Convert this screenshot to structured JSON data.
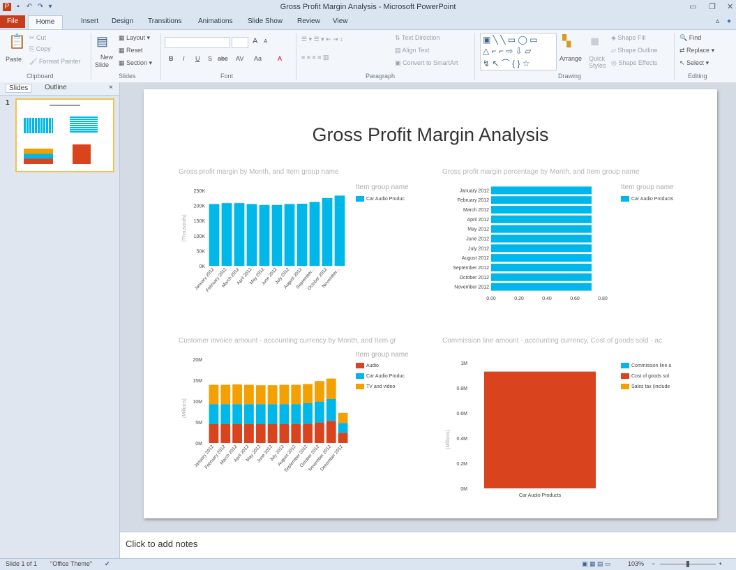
{
  "window": {
    "title": "Gross Profit Margin Analysis - Microsoft PowerPoint"
  },
  "tabs": [
    "File",
    "Home",
    "Insert",
    "Design",
    "Transitions",
    "Animations",
    "Slide Show",
    "Review",
    "View"
  ],
  "ribbon": {
    "clipboard": {
      "paste": "Paste",
      "cut": "Cut",
      "copy": "Copy",
      "format_painter": "Format Painter",
      "label": "Clipboard"
    },
    "slides": {
      "new_slide": "New",
      "new_slide2": "Slide",
      "layout": "Layout",
      "reset": "Reset",
      "section": "Section",
      "label": "Slides"
    },
    "font": {
      "label": "Font",
      "bold": "B",
      "italic": "I",
      "underline": "U",
      "strike": "S",
      "shadow": "abc",
      "spacing": "AV",
      "case": "Aa",
      "color": "A",
      "grow": "A",
      "shrink": "A"
    },
    "paragraph": {
      "text_direction": "Text Direction",
      "align_text": "Align Text",
      "convert_smartart": "Convert to SmartArt",
      "label": "Paragraph"
    },
    "drawing": {
      "arrange": "Arrange",
      "quick_styles": "Quick",
      "quick_styles2": "Styles",
      "shape_fill": "Shape Fill",
      "shape_outline": "Shape Outline",
      "shape_effects": "Shape Effects",
      "label": "Drawing"
    },
    "editing": {
      "find": "Find",
      "replace": "Replace",
      "select": "Select",
      "label": "Editing"
    }
  },
  "pane": {
    "tab_slides": "Slides",
    "tab_outline": "Outline",
    "close": "×",
    "slide_number": "1"
  },
  "slide": {
    "title": "Gross Profit Margin Analysis"
  },
  "notes": {
    "placeholder": "Click to add notes"
  },
  "status": {
    "slide_info": "Slide 1 of 1",
    "theme": "\"Office Theme\"",
    "zoom": "103%",
    "zoom_minus": "−",
    "zoom_plus": "+"
  },
  "colors": {
    "cyan": "#00b7ea",
    "orange_red": "#d9431e",
    "amber": "#f4a000"
  },
  "chart_data": [
    {
      "type": "bar",
      "title": "Gross profit margin by Month, and Item group name",
      "categories": [
        "January 2012",
        "February 2012",
        "March 2012",
        "April 2012",
        "May 2012",
        "June 2012",
        "July 2012",
        "August 2012",
        "September...",
        "October 2012",
        "November..."
      ],
      "series": [
        {
          "name": "Car Audio Products",
          "values": [
            205,
            208,
            208,
            205,
            202,
            202,
            205,
            206,
            212,
            225,
            233
          ]
        }
      ],
      "ylabel": "(Thousands)",
      "yticks": [
        "0K",
        "50K",
        "100K",
        "150K",
        "200K",
        "250K"
      ],
      "ylim": [
        0,
        250
      ],
      "legend_title": "Item group name",
      "legend_labels": [
        "Car Audio Produc"
      ]
    },
    {
      "type": "bar",
      "orientation": "horizontal",
      "title": "Gross profit margin percentage by Month, and Item group name",
      "categories": [
        "January 2012",
        "February 2012",
        "March 2012",
        "April 2012",
        "May 2012",
        "June 2012",
        "July 2012",
        "August 2012",
        "September 2012",
        "October 2012",
        "November 2012"
      ],
      "series": [
        {
          "name": "Car Audio Products",
          "values": [
            0.72,
            0.72,
            0.72,
            0.72,
            0.72,
            0.72,
            0.72,
            0.72,
            0.72,
            0.72,
            0.72
          ]
        }
      ],
      "xticks": [
        "0.00",
        "0.20",
        "0.40",
        "0.60",
        "0.80"
      ],
      "xlim": [
        0,
        0.8
      ],
      "legend_title": "Item group name",
      "legend_labels": [
        "Car Audio Products"
      ]
    },
    {
      "type": "bar",
      "stacked": true,
      "title": "Customer invoice amount - accounting currency by Month, and Item gr",
      "categories": [
        "January 2012",
        "February 2012",
        "March 2012",
        "April 2012",
        "May 2012",
        "June 2012",
        "July 2012",
        "August 2012",
        "September 2012",
        "October 2012",
        "November 2012",
        "December 2012"
      ],
      "series": [
        {
          "name": "Audio",
          "values": [
            4.5,
            4.5,
            4.5,
            4.5,
            4.5,
            4.5,
            4.5,
            4.5,
            4.6,
            4.9,
            5.3,
            2.4
          ]
        },
        {
          "name": "Car Audio Products",
          "values": [
            4.8,
            4.8,
            4.8,
            4.8,
            4.8,
            4.8,
            4.8,
            4.8,
            4.9,
            5.0,
            5.2,
            2.4
          ]
        },
        {
          "name": "TV and video",
          "values": [
            4.6,
            4.6,
            4.7,
            4.6,
            4.5,
            4.5,
            4.6,
            4.6,
            4.6,
            4.9,
            4.9,
            2.4
          ]
        }
      ],
      "ylabel": "(Millions)",
      "yticks": [
        "0M",
        "5M",
        "10M",
        "15M",
        "20M"
      ],
      "ylim": [
        0,
        20
      ],
      "legend_title": "Item group name",
      "legend_labels": [
        "Audio",
        "Car Audio Produc",
        "TV and video"
      ]
    },
    {
      "type": "bar",
      "title": "Commission line amount - accounting currency, Cost of goods sold - ac",
      "categories": [
        "Car Audio Products"
      ],
      "series": [
        {
          "name": "Commission line",
          "values": [
            0
          ]
        },
        {
          "name": "Cost of goods sold",
          "values": [
            0.93
          ]
        },
        {
          "name": "Sales tax (include",
          "values": [
            0
          ]
        }
      ],
      "ylabel": "(Millions)",
      "yticks": [
        "0M",
        "0.2M",
        "0.4M",
        "0.6M",
        "0.8M",
        "1M"
      ],
      "ylim": [
        0,
        1
      ],
      "legend_labels": [
        "Commission line a",
        "Cost of goods sol",
        "Sales tax (include"
      ]
    }
  ]
}
